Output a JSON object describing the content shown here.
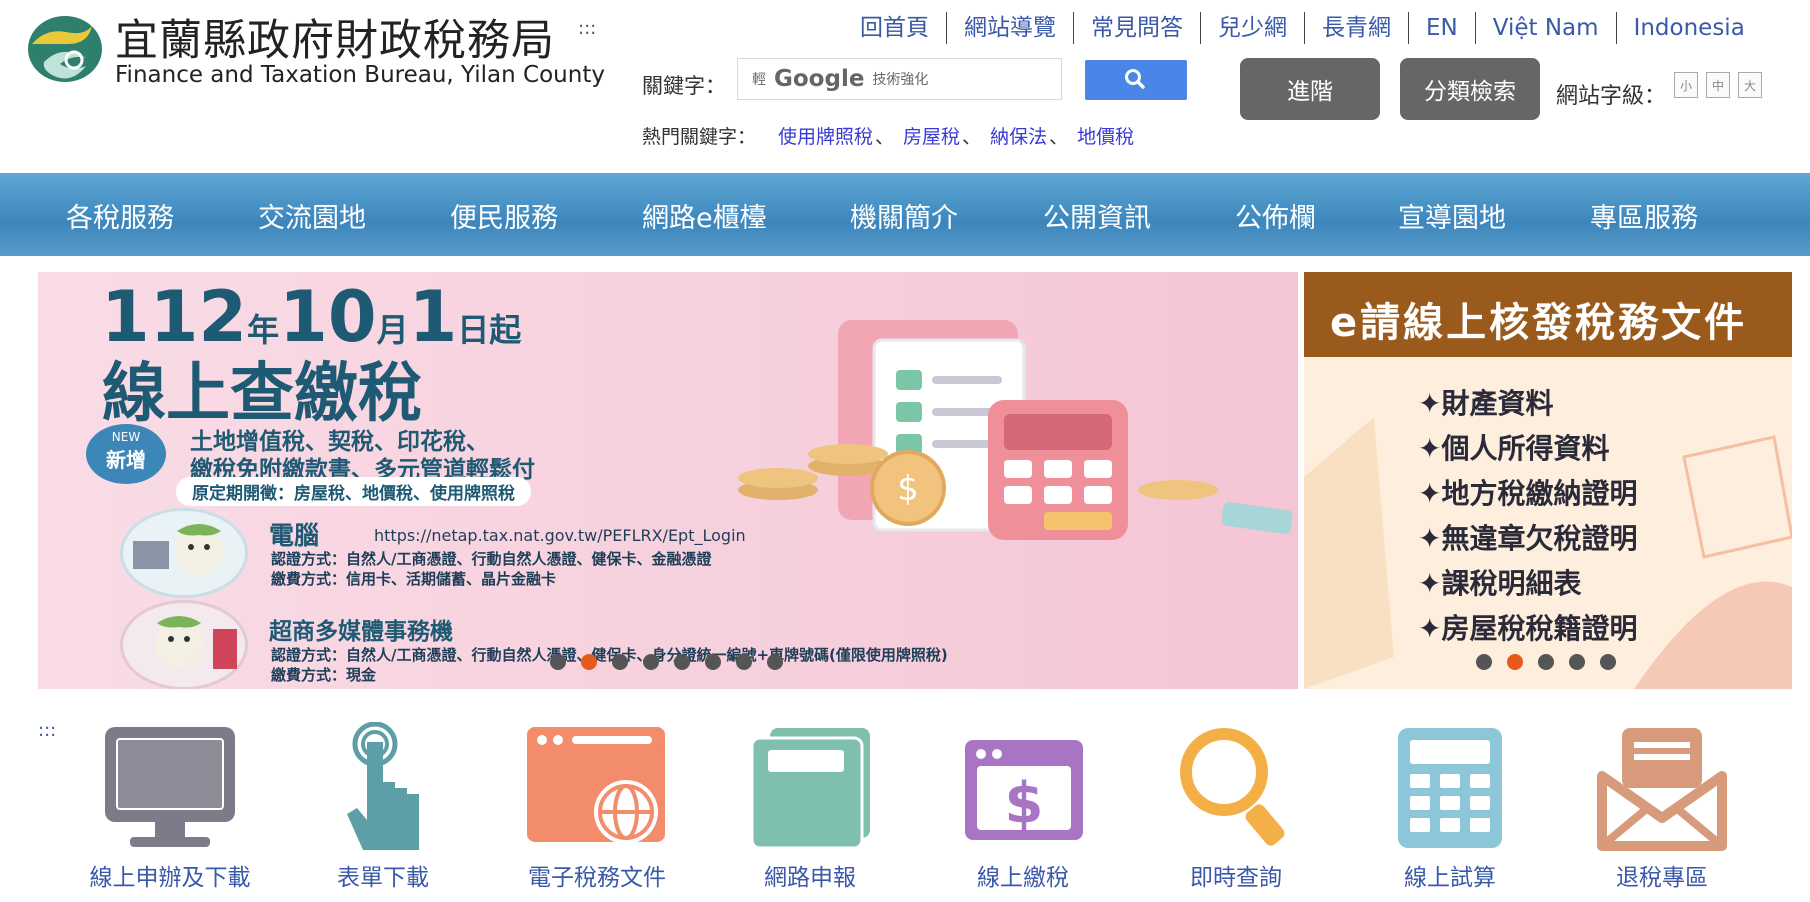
{
  "site": {
    "title_zh": "宜蘭縣政府財政稅務局",
    "title_en": "Finance and Taxation Bureau, Yilan County",
    "accesskey_top": ":::"
  },
  "top_links": [
    "回首頁",
    "網站導覽",
    "常見問答",
    "兒少網",
    "長青網",
    "EN",
    "Việt Nam",
    "Indonesia"
  ],
  "search": {
    "label": "關鍵字：",
    "google_prefix": "輕",
    "google_word": "Google",
    "google_suffix": "技術強化",
    "advanced_label": "進階",
    "category_label": "分類檢索",
    "fontsize_label": "網站字級：",
    "fontsize_options": [
      "小",
      "中",
      "大"
    ]
  },
  "hot_keywords": {
    "label": "熱門關鍵字：",
    "items": [
      "使用牌照稅",
      "房屋稅",
      "納保法",
      "地價稅"
    ],
    "separator": "、"
  },
  "nav": [
    "各稅服務",
    "交流園地",
    "便民服務",
    "網路e櫃檯",
    "機關簡介",
    "公開資訊",
    "公佈欄",
    "宣導園地",
    "專區服務"
  ],
  "banner_main": {
    "date_y": "112",
    "date_y_unit": "年",
    "date_m": "10",
    "date_m_unit": "月",
    "date_d": "1",
    "date_d_unit": "日起",
    "headline": "線上查繳稅",
    "new_badge_en": "NEW",
    "new_badge_zh": "新增",
    "new_line1": "土地增值稅、契稅、印花稅、",
    "new_line2": "繳稅免附繳款書、多元管道輕鬆付",
    "regular_line": "原定期開徵：房屋稅、地價稅、使用牌照稅",
    "pc_title": "電腦",
    "pc_url": "https://netap.tax.nat.gov.tw/PEFLRX/Ept_Login",
    "pc_auth": "認證方式：自然人/工商憑證、行動自然人憑證、健保卡、金融憑證",
    "pc_pay": "繳費方式：信用卡、活期儲蓄、晶片金融卡",
    "kiosk_title": "超商多媒體事務機",
    "kiosk_auth": "認證方式：自然人/工商憑證、行動自然人憑證、健保卡、身分證統一編號+車牌號碼(僅限使用牌照稅)",
    "kiosk_pay": "繳費方式：現金",
    "dots_count": 8,
    "active_dot": 1
  },
  "banner_side": {
    "title": "e請線上核發稅務文件",
    "items": [
      "財產資料",
      "個人所得資料",
      "地方稅繳納證明",
      "無違章欠稅證明",
      "課稅明細表",
      "房屋稅稅籍證明"
    ],
    "dots_count": 5,
    "active_dot": 1
  },
  "icons_accesskey": ":::",
  "services": [
    {
      "label": "線上申辦及下載",
      "icon": "monitor-icon",
      "color": "#7f7a8a"
    },
    {
      "label": "表單下載",
      "icon": "touch-hand-icon",
      "color": "#5e9ea6"
    },
    {
      "label": "電子稅務文件",
      "icon": "web-globe-icon",
      "color": "#f28c6a"
    },
    {
      "label": "網路申報",
      "icon": "document-folder-icon",
      "color": "#7fbfae"
    },
    {
      "label": "線上繳稅",
      "icon": "dollar-window-icon",
      "color": "#a874c4"
    },
    {
      "label": "即時查詢",
      "icon": "magnifier-icon",
      "color": "#f4b046"
    },
    {
      "label": "線上試算",
      "icon": "calculator-icon",
      "color": "#8ec6d9"
    },
    {
      "label": "退稅專區",
      "icon": "envelope-icon",
      "color": "#d79a7a"
    }
  ]
}
